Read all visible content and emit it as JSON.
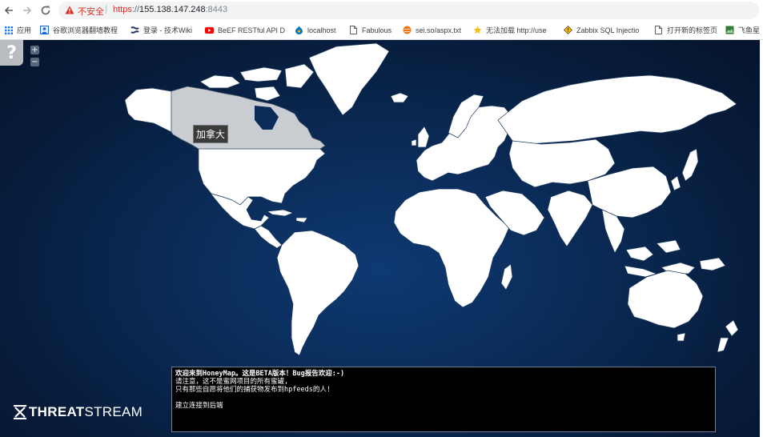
{
  "browser": {
    "insecure_label": "不安全",
    "url": {
      "scheme": "https",
      "separator": "://",
      "host": "155.138.147.248",
      "port": ":8443"
    },
    "bookmarks": [
      {
        "label": "应用",
        "icon": "apps-grid-icon"
      },
      {
        "label": "谷歌浏览器翻墙教程",
        "icon": "photo-icon"
      },
      {
        "label": "登录 - 技术Wiki",
        "icon": "confluence-icon"
      },
      {
        "label": "BeEF RESTful API D",
        "icon": "youtube-icon"
      },
      {
        "label": "localhost",
        "icon": "drupal-icon"
      },
      {
        "label": "Fabulous",
        "icon": "page-icon"
      },
      {
        "label": "sei.so/aspx.txt",
        "icon": "ball-icon"
      },
      {
        "label": "无法加载 http://use",
        "icon": "star-icon"
      },
      {
        "label": "Zabbix SQL Injectio",
        "icon": "warning-icon"
      },
      {
        "label": "打开新的标签页",
        "icon": "page-icon"
      },
      {
        "label": "飞鱼星",
        "icon": "photo-icon"
      }
    ]
  },
  "map": {
    "help_label": "?",
    "zoom_in_label": "+",
    "zoom_out_label": "−",
    "hover_tooltip": "加拿大",
    "colors": {
      "land": "#ffffff",
      "highlight": "#c9ccd1",
      "ocean_center": "#0e3a72",
      "ocean_edge": "#05142b"
    }
  },
  "logo": {
    "prefix": "THREAT",
    "suffix": "STREAM"
  },
  "console": {
    "lines": [
      "欢迎来到HoneyMap。这是BETA版本！Bug报告欢迎:-)",
      "请注意，这不是蜜网项目的所有蜜罐,",
      "只有那些自愿将他们的捕获物发布到hpfeeds的人!",
      "",
      "建立连接到后端"
    ]
  }
}
